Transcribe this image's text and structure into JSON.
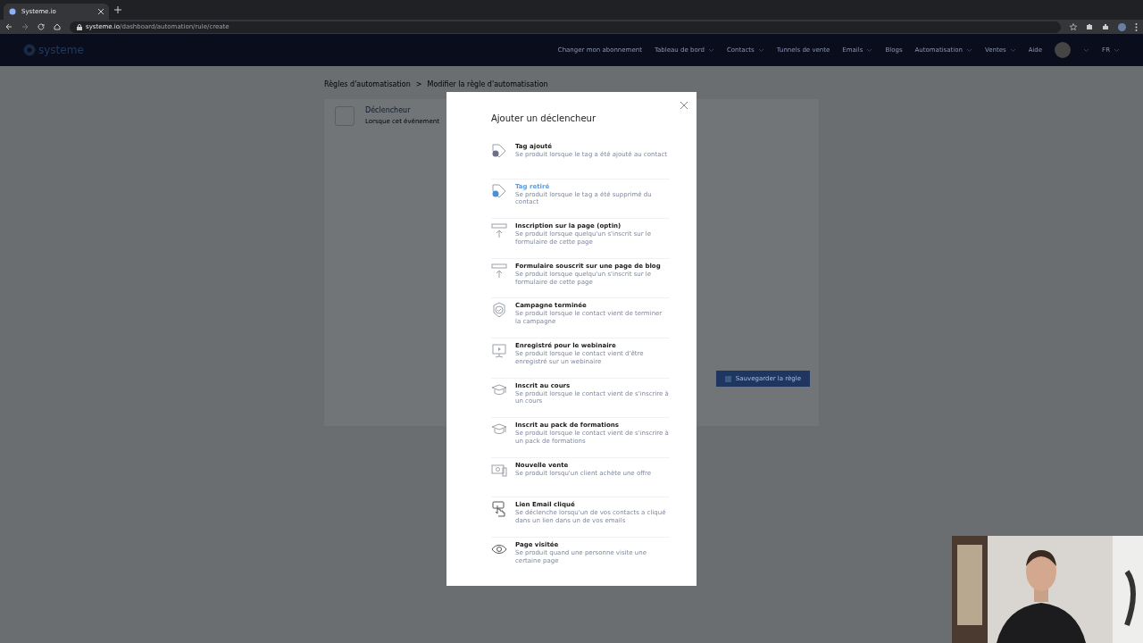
{
  "browser": {
    "tab_title": "Systeme.io",
    "url_host": "systeme.io",
    "url_path": "/dashboard/automation/rule/create"
  },
  "navbar": {
    "logo": "systeme",
    "items": [
      {
        "label": "Changer mon abonnement",
        "dropdown": false
      },
      {
        "label": "Tableau de bord",
        "dropdown": true
      },
      {
        "label": "Contacts",
        "dropdown": true
      },
      {
        "label": "Tunnels de vente",
        "dropdown": false
      },
      {
        "label": "Emails",
        "dropdown": true
      },
      {
        "label": "Blogs",
        "dropdown": false
      },
      {
        "label": "Automatisation",
        "dropdown": true
      },
      {
        "label": "Ventes",
        "dropdown": true
      },
      {
        "label": "Aide",
        "dropdown": false
      }
    ],
    "language": "FR"
  },
  "breadcrumb": [
    "Règles d'automatisation",
    "Modifier la règle d'automatisation"
  ],
  "breadcrumb_separator": ">",
  "trigger_card": {
    "title": "Déclencheur",
    "description": "Lorsque cet événement"
  },
  "save_button": "Sauvegarder la règle",
  "modal": {
    "title": "Ajouter un déclencheur",
    "triggers": [
      {
        "kind": "tag",
        "title": "Tag ajouté",
        "description": "Se produit lorsque le tag a été ajouté au contact",
        "highlighted": false
      },
      {
        "kind": "tag",
        "title": "Tag retiré",
        "description": "Se produit lorsque le tag a été supprimé du contact",
        "highlighted": true
      },
      {
        "kind": "form",
        "title": "Inscription sur la page (optin)",
        "description": "Se produit lorsque quelqu'un s'inscrit sur le formulaire de cette page",
        "highlighted": false
      },
      {
        "kind": "form",
        "title": "Formulaire souscrit sur une page de blog",
        "description": "Se produit lorsque quelqu'un s'inscrit sur le formulaire de cette page",
        "highlighted": false
      },
      {
        "kind": "badge",
        "title": "Campagne terminée",
        "description": "Se produit lorsque le contact vient de terminer la campagne",
        "highlighted": false
      },
      {
        "kind": "screen",
        "title": "Enregistré pour le webinaire",
        "description": "Se produit lorsque le contact vient d'être enregistré sur un webinaire",
        "highlighted": false
      },
      {
        "kind": "cap",
        "title": "Inscrit au cours",
        "description": "Se produit lorsque le contact vient de s'inscrire à un cours",
        "highlighted": false
      },
      {
        "kind": "cap",
        "title": "Inscrit au pack de formations",
        "description": "Se produit lorsque le contact vient de s'inscrire à un pack de formations",
        "highlighted": false
      },
      {
        "kind": "money",
        "title": "Nouvelle vente",
        "description": "Se produit lorsqu'un client achète une offre",
        "highlighted": false
      },
      {
        "kind": "hand",
        "title": "Lien Email cliqué",
        "description": "Se déclenche lorsqu'un de vos contacts a cliqué dans un lien dans un de vos emails",
        "highlighted": false
      },
      {
        "kind": "eye",
        "title": "Page visitée",
        "description": "Se produit quand une personne visite une certaine page",
        "highlighted": false
      }
    ]
  }
}
